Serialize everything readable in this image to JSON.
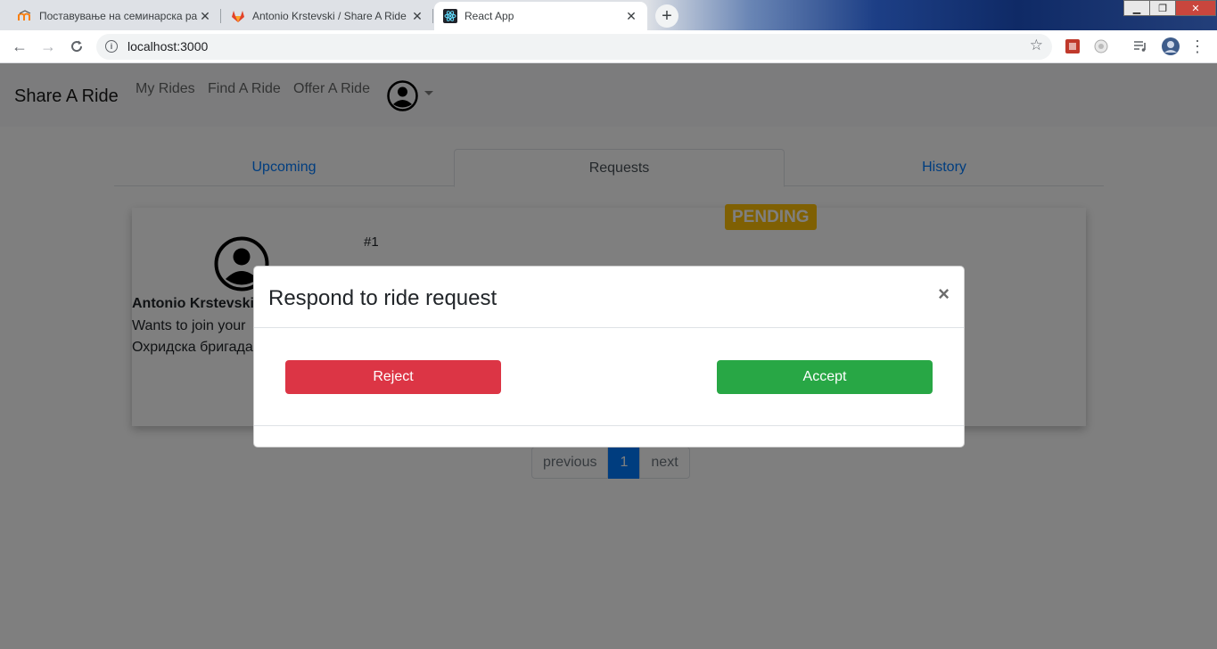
{
  "browser": {
    "tabs": [
      {
        "title": "Поставување на семинарска ра",
        "icon": "moodle-icon",
        "active": false
      },
      {
        "title": "Antonio Krstevski / Share A Ride",
        "icon": "gitlab-icon",
        "active": false
      },
      {
        "title": "React App",
        "icon": "react-icon",
        "active": true
      }
    ],
    "new_tab_symbol": "+",
    "url": "localhost:3000",
    "window_controls": {
      "minimize": "▁",
      "maximize": "❐",
      "close": "✕"
    }
  },
  "app": {
    "brand": "Share A Ride",
    "nav": {
      "my_rides": "My Rides",
      "find_ride": "Find A Ride",
      "offer_ride": "Offer A Ride"
    },
    "tabs": {
      "upcoming": "Upcoming",
      "requests": "Requests",
      "history": "History",
      "active": "Requests"
    },
    "request_card": {
      "user_name": "Antonio Krstevski",
      "line1": "Wants to join your",
      "line2": "Охридска бригада",
      "ride_number": "#1",
      "status": "PENDING",
      "status_color": "#ffc107"
    },
    "pagination": {
      "previous": "previous",
      "current": "1",
      "next": "next"
    }
  },
  "modal": {
    "title": "Respond to ride request",
    "close_symbol": "×",
    "reject_label": "Reject",
    "accept_label": "Accept",
    "reject_color": "#dc3545",
    "accept_color": "#28a745"
  }
}
